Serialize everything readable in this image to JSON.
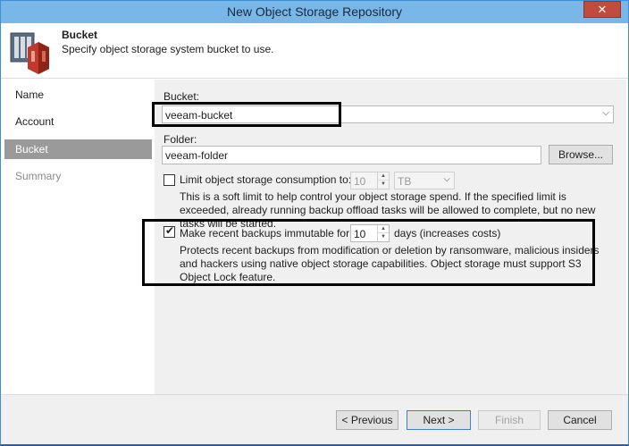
{
  "window": {
    "title": "New Object Storage Repository",
    "close_glyph": "✕"
  },
  "header": {
    "title": "Bucket",
    "subtitle": "Specify object storage system bucket to use.",
    "icon": "object-storage-repository-icon"
  },
  "sidebar": {
    "items": [
      {
        "label": "Name",
        "state": "normal"
      },
      {
        "label": "Account",
        "state": "normal"
      },
      {
        "label": "Bucket",
        "state": "active"
      },
      {
        "label": "Summary",
        "state": "disabled"
      }
    ]
  },
  "bucket": {
    "label": "Bucket:",
    "value": "veeam-bucket"
  },
  "folder": {
    "label": "Folder:",
    "value": "veeam-folder",
    "browse_label": "Browse..."
  },
  "limit": {
    "label": "Limit object storage consumption to:",
    "checked": false,
    "value": "10",
    "unit": "TB",
    "description": "This is a soft limit to help control your object storage spend. If the specified limit is exceeded, already running backup offload tasks will be allowed to complete, but no new tasks will be started."
  },
  "immutable": {
    "label": "Make recent backups immutable for:",
    "checked": true,
    "value": "10",
    "suffix": "days (increases costs)",
    "description": "Protects recent backups from modification or deletion by ransomware, malicious insiders and hackers using native object storage capabilities. Object storage must support S3 Object Lock feature."
  },
  "footer": {
    "previous_label": "< Previous",
    "next_label": "Next >",
    "finish_label": "Finish",
    "cancel_label": "Cancel"
  },
  "colors": {
    "titlebar": "#78b7e8",
    "close_button": "#c24a3e",
    "sidebar_active": "#9a9a9a",
    "highlight_box": "#000000"
  }
}
